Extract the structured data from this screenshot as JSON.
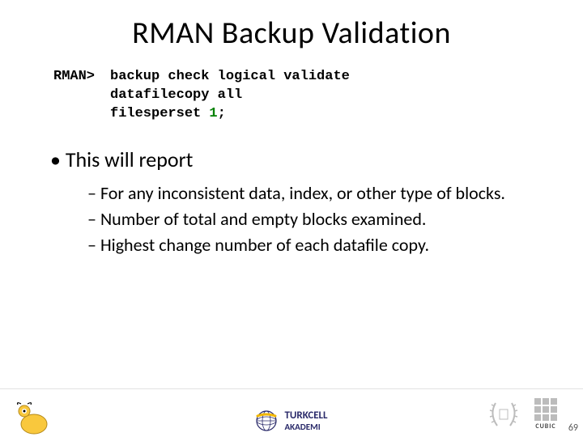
{
  "title": "RMAN Backup Validation",
  "code": {
    "prompt": "RMAN>",
    "line1": "backup check logical validate",
    "line2": "datafilecopy all",
    "line3_a": "filesperset ",
    "line3_num": "1",
    "line3_b": ";"
  },
  "bullet": "This will report",
  "subs": [
    "For any inconsistent data, index, or other type of blocks.",
    "Number of total and empty blocks examined.",
    "Highest change number of each datafile copy."
  ],
  "footer": {
    "page": "69",
    "turkcell_top": "TURKCELL",
    "turkcell_bot": "AKADEMI",
    "cubic": "CUBIC"
  }
}
